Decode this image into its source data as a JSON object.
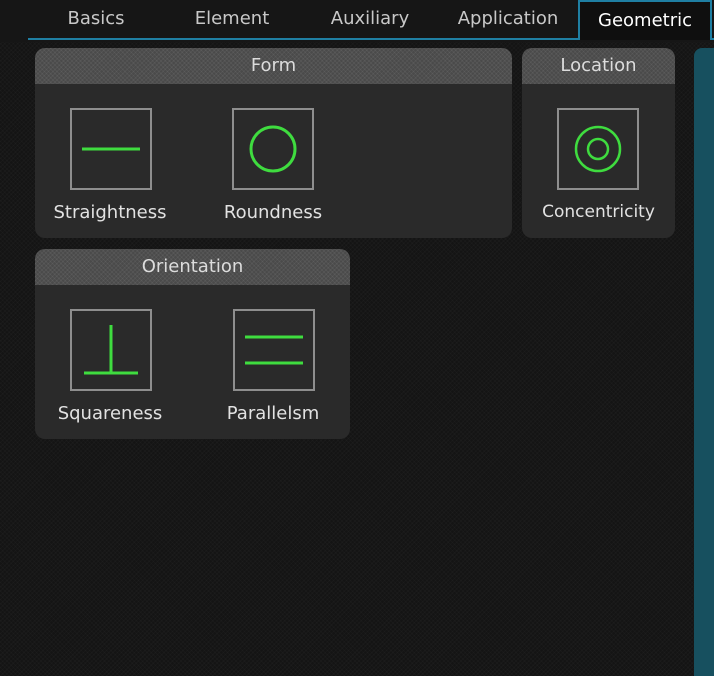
{
  "tabs": [
    {
      "label": "Basics",
      "active": false
    },
    {
      "label": "Element",
      "active": false
    },
    {
      "label": "Auxiliary",
      "active": false
    },
    {
      "label": "Application",
      "active": false
    },
    {
      "label": "Geometric",
      "active": true
    }
  ],
  "groups": {
    "form": {
      "title": "Form",
      "tools": [
        {
          "label": "Straightness",
          "icon": "straightness-icon"
        },
        {
          "label": "Roundness",
          "icon": "roundness-icon"
        }
      ]
    },
    "location": {
      "title": "Location",
      "tools": [
        {
          "label": "Concentricity",
          "icon": "concentricity-icon"
        }
      ]
    },
    "orientation": {
      "title": "Orientation",
      "tools": [
        {
          "label": "Squareness",
          "icon": "squareness-icon"
        },
        {
          "label": "Parallelsm",
          "icon": "parallelism-icon"
        }
      ]
    }
  },
  "colors": {
    "accent": "#1f7fa3",
    "icon_stroke": "#3fdc3f",
    "panel": "#2a2a2a",
    "header": "#4a4a4a"
  }
}
